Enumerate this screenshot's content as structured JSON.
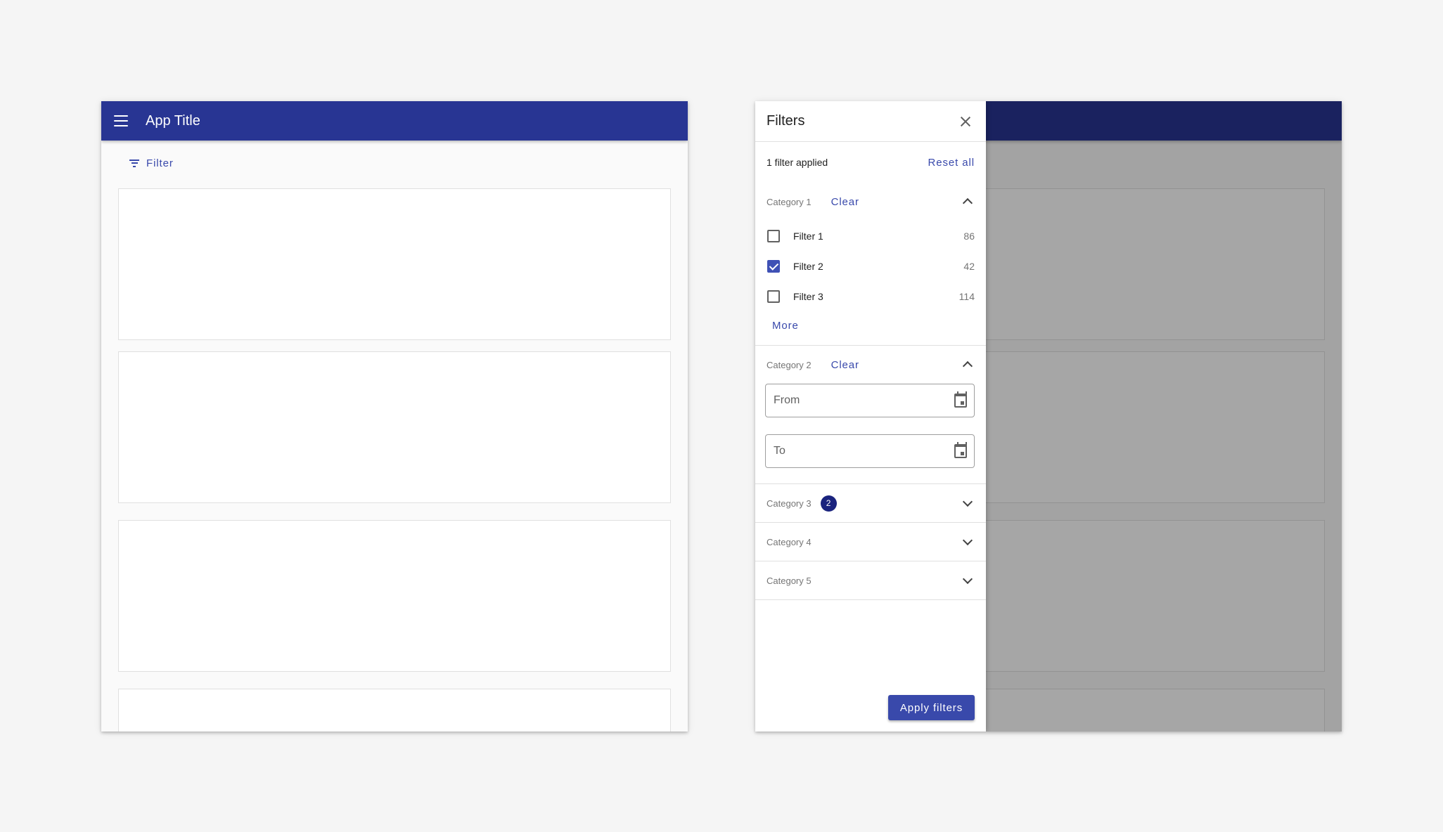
{
  "left_screen": {
    "app_title": "App Title",
    "menu_icon": "menu-icon",
    "filter_button": {
      "label": "Filter",
      "icon": "filter-icon"
    },
    "cards": 4
  },
  "drawer": {
    "title": "Filters",
    "close_icon": "close-icon",
    "summary": {
      "text": "1 filter applied",
      "reset_label": "Reset all"
    },
    "category1": {
      "label": "Category 1",
      "clear_label": "Clear",
      "expanded": true,
      "filters": [
        {
          "name": "Filter 1",
          "count": "86",
          "checked": false
        },
        {
          "name": "Filter 2",
          "count": "42",
          "checked": true
        },
        {
          "name": "Filter 3",
          "count": "114",
          "checked": false
        }
      ],
      "more_label": "More"
    },
    "category2": {
      "label": "Category 2",
      "clear_label": "Clear",
      "expanded": true,
      "from_label": "From",
      "to_label": "To"
    },
    "category3": {
      "label": "Category 3",
      "badge": "2",
      "expanded": false
    },
    "category4": {
      "label": "Category 4",
      "expanded": false
    },
    "category5": {
      "label": "Category 5",
      "expanded": false
    },
    "apply_label": "Apply filters"
  },
  "colors": {
    "appbar": "#283593",
    "accent": "#3949ab",
    "badge": "#1a237e"
  }
}
